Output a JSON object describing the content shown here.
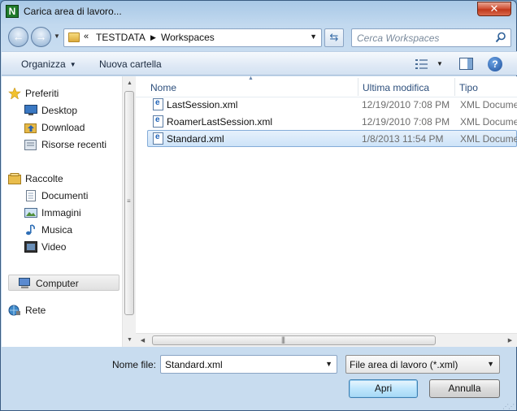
{
  "window": {
    "title": "Carica area di lavoro...",
    "app_icon_letter": "N",
    "close_glyph": "✕"
  },
  "navbar": {
    "history_glyph": "▼",
    "breadcrumb_prefix": "«",
    "breadcrumb": [
      "TESTDATA",
      "Workspaces"
    ],
    "breadcrumb_sep": "▶",
    "search_placeholder": "Cerca Workspaces"
  },
  "toolbar": {
    "organize_label": "Organizza",
    "new_folder_label": "Nuova cartella",
    "help_glyph": "?"
  },
  "sidebar": {
    "items": [
      {
        "label": "Preferiti",
        "icon": "star-icon"
      },
      {
        "label": "Desktop",
        "icon": "desktop-icon"
      },
      {
        "label": "Download",
        "icon": "download-folder-icon"
      },
      {
        "label": "Risorse recenti",
        "icon": "recent-places-icon"
      },
      {
        "label": "Raccolte",
        "icon": "libraries-icon"
      },
      {
        "label": "Documenti",
        "icon": "documents-icon"
      },
      {
        "label": "Immagini",
        "icon": "pictures-icon"
      },
      {
        "label": "Musica",
        "icon": "music-icon"
      },
      {
        "label": "Video",
        "icon": "video-icon"
      },
      {
        "label": "Computer",
        "icon": "computer-icon"
      },
      {
        "label": "Rete",
        "icon": "network-icon"
      }
    ]
  },
  "file_list": {
    "columns": [
      "Nome",
      "Ultima modifica",
      "Tipo"
    ],
    "rows": [
      {
        "name": "LastSession.xml",
        "modified": "12/19/2010 7:08 PM",
        "type": "XML Document"
      },
      {
        "name": "RoamerLastSession.xml",
        "modified": "12/19/2010 7:08 PM",
        "type": "XML Document"
      },
      {
        "name": "Standard.xml",
        "modified": "1/8/2013 11:54 PM",
        "type": "XML Document"
      }
    ],
    "selected_index": 2
  },
  "bottom": {
    "filename_label": "Nome file:",
    "filename_value": "Standard.xml",
    "filetype_value": "File area di lavoro (*.xml)",
    "open_label": "Apri",
    "cancel_label": "Annulla"
  },
  "colors": {
    "accent": "#3c7fb1",
    "selection": "#cde3f8",
    "header_text": "#2d4f7c"
  }
}
